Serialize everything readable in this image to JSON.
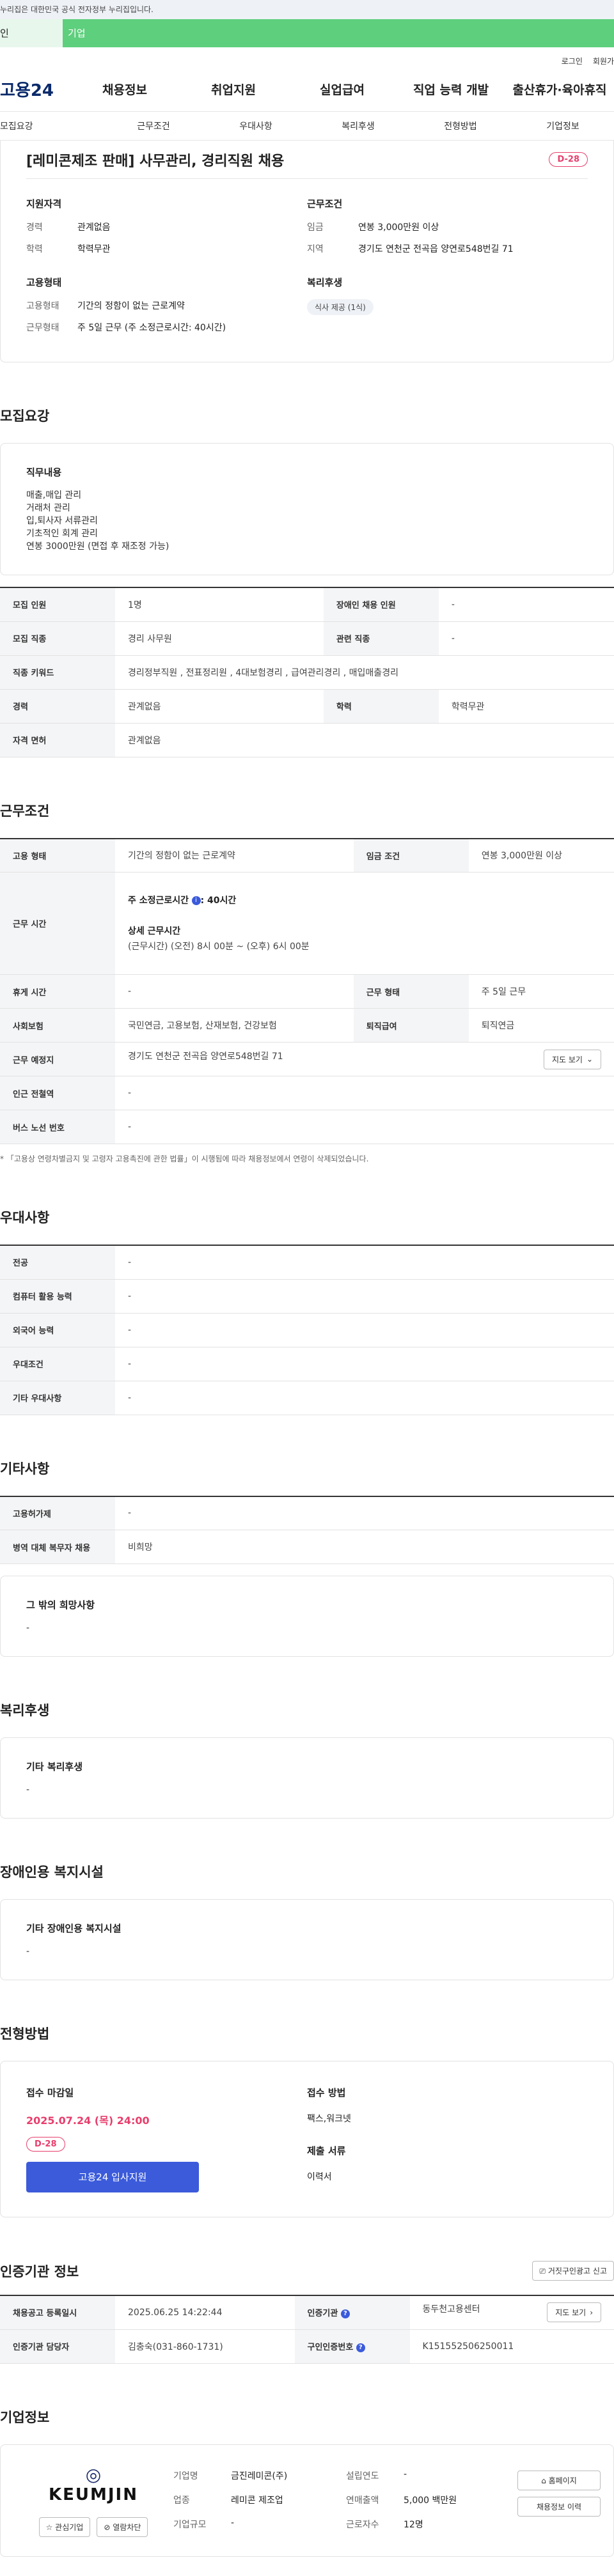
{
  "gov_bar": {
    "text": "누리집은 대한민국 공식 전자정부 누리집입니다."
  },
  "user_tabs": {
    "person": "인",
    "business": "기업"
  },
  "util": {
    "login": "로그인",
    "signup": "회원가"
  },
  "gnb": {
    "logo": "고용24",
    "items": [
      "채용정보",
      "취업지원",
      "실업급여",
      "직업 능력 개발",
      "출산휴가·육아휴직"
    ]
  },
  "subnav": [
    "모집요강",
    "근무조건",
    "우대사항",
    "복리후생",
    "전형방법",
    "기업정보"
  ],
  "job": {
    "title": "[레미콘제조 판매] 사무관리, 경리직원 채용",
    "dday": "D-28",
    "qual_head": "지원자격",
    "career_k": "경력",
    "career_v": "관계없음",
    "edu_k": "학력",
    "edu_v": "학력무관",
    "emp_head": "고용형태",
    "emp_k": "고용형태",
    "emp_v": "기간의 정함이 없는 근로계약",
    "work_k": "근무형태",
    "work_v": "주 5일 근무 (주 소정근로시간: 40시간)",
    "cond_head": "근무조건",
    "wage_k": "임금",
    "wage_v": "연봉 3,000만원 이상",
    "area_k": "지역",
    "area_v": "경기도 연천군 전곡읍 양연로548번길 71",
    "welfare_head": "복리후생",
    "welfare_chip": "식사 제공 (1식)"
  },
  "recruit": {
    "title": "모집요강",
    "duty_title": "직무내용",
    "duty_text": "매출,매입 관리\n거래처 관리\n입,퇴사자 서류관리\n기초적인 회계 관리\n연봉 3000만원 (면접 후 재조정 가능)",
    "rows": [
      {
        "k1": "모집 인원",
        "v1": "1명",
        "k2": "장애인 채용 인원",
        "v2": "-"
      },
      {
        "k1": "모집 직종",
        "v1": "경리 사무원",
        "k2": "관련 직종",
        "v2": "-"
      }
    ],
    "keyword_k": "직종 키워드",
    "keyword_v": "경리정부직원 , 전표정리원 , 4대보험경리 , 급여관리경리 , 매입매출경리",
    "career_k": "경력",
    "career_v": "관계없음",
    "edu_k": "학력",
    "edu_v": "학력무관",
    "license_k": "자격 면허",
    "license_v": "관계없음"
  },
  "workcond": {
    "title": "근무조건",
    "emp_k": "고용 형태",
    "emp_v": "기간의 정함이 없는 근로계약",
    "wage_k": "임금 조건",
    "wage_v": "연봉 3,000만원 이상",
    "hours_k": "근무 시간",
    "hours_label": "주 소정근로시간",
    "hours_value": ": 40시간",
    "hours_detail_label": "상세 근무시간",
    "hours_detail": "(근무시간) (오전) 8시 00분 ~ (오후) 6시 00분",
    "rest_k": "휴게 시간",
    "rest_v": "-",
    "form_k": "근무 형태",
    "form_v": "주 5일 근무",
    "ins_k": "사회보험",
    "ins_v": "국민연금, 고용보험, 산재보험, 건강보험",
    "ret_k": "퇴직급여",
    "ret_v": "퇴직연금",
    "place_k": "근무 예정지",
    "place_v": "경기도 연천군 전곡읍 양연로548번길 71",
    "map_btn": "지도 보기",
    "subway_k": "인근 전철역",
    "subway_v": "-",
    "bus_k": "버스 노선 번호",
    "bus_v": "-",
    "notice": "* 「고용상 연령차별금지 및 고령자 고용촉진에 관한 법률」이 시행됨에 따라 채용정보에서 연령이 삭제되었습니다."
  },
  "pref": {
    "title": "우대사항",
    "rows": [
      {
        "k": "전공",
        "v": "-"
      },
      {
        "k": "컴퓨터 활용 능력",
        "v": "-"
      },
      {
        "k": "외국어 능력",
        "v": "-"
      },
      {
        "k": "우대조건",
        "v": "-"
      },
      {
        "k": "기타 우대사항",
        "v": "-"
      }
    ]
  },
  "etc": {
    "title": "기타사항",
    "rows": [
      {
        "k": "고용허가제",
        "v": "-"
      },
      {
        "k": "병역 대체 복무자 채용",
        "v": "비희망"
      }
    ],
    "hope_title": "그 밖의 희망사항",
    "hope_v": "-"
  },
  "welfare": {
    "title": "복리후생",
    "box_title": "기타 복리후생",
    "box_v": "-"
  },
  "disabled": {
    "title": "장애인용 복지시설",
    "box_title": "기타 장애인용 복지시설",
    "box_v": "-"
  },
  "selection": {
    "title": "전형방법",
    "deadline_label": "접수 마감일",
    "deadline": "2025.07.24 (목) 24:00",
    "dday": "D-28",
    "apply_btn": "고용24 입사지원",
    "method_label": "접수 방법",
    "method_v": "팩스,워크넷",
    "docs_label": "제출 서류",
    "docs_v": "이력서"
  },
  "cert": {
    "title": "인증기관 정보",
    "report_btn": "거짓구인광고 신고",
    "reg_k": "채용공고 등록일시",
    "reg_v": "2025.06.25 14:22:44",
    "org_k": "인증기관",
    "org_v": "동두천고용센터",
    "map_btn": "지도 보기",
    "staff_k": "인증기관 담당자",
    "staff_v": "김충숙(031-860-1731)",
    "num_k": "구인인증번호",
    "num_v": "K151552506250011"
  },
  "company": {
    "title": "기업정보",
    "logo_text": "KEUMJIN",
    "fav_btn": "관심기업",
    "block_btn": "열람차단",
    "name_k": "기업명",
    "name_v": "금진레미콘(주)",
    "est_k": "설립연도",
    "est_v": "-",
    "ind_k": "업종",
    "ind_v": "레미콘 제조업",
    "sales_k": "연매출액",
    "sales_v": "5,000 백만원",
    "size_k": "기업규모",
    "size_v": "-",
    "emp_k": "근로자수",
    "emp_v": "12명",
    "home_btn": "홈페이지",
    "history_btn": "채용정보 이력"
  }
}
